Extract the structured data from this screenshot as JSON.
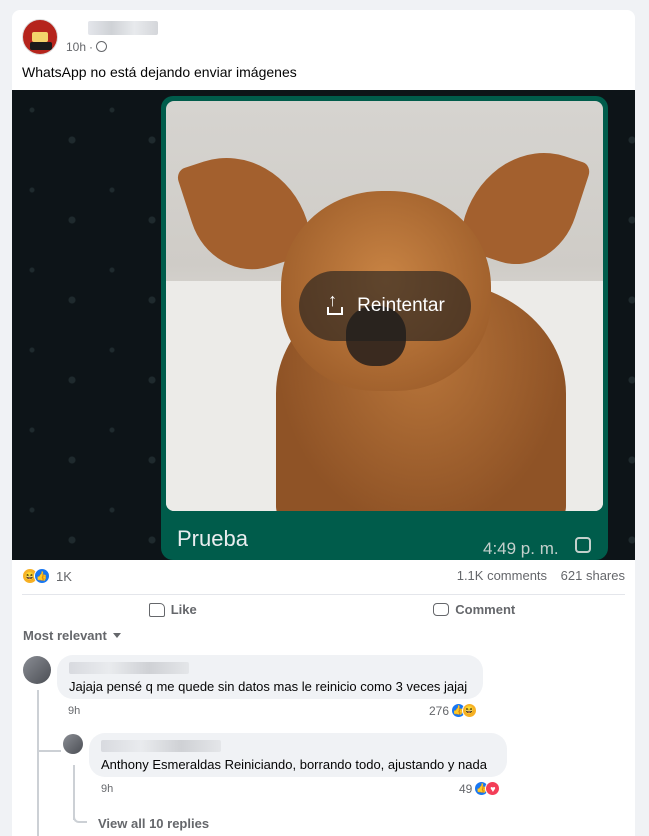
{
  "post": {
    "time": "10h",
    "time_separator": "·",
    "text": "WhatsApp no está dejando enviar imágenes"
  },
  "media": {
    "retry_label": "Reintentar",
    "caption": "Prueba",
    "message_time": "4:49 p. m."
  },
  "stats": {
    "reactions_count": "1K",
    "comments": "1.1K comments",
    "shares": "621 shares",
    "reaction_icons": [
      "haha",
      "like"
    ]
  },
  "actions": {
    "like_label": "Like",
    "comment_label": "Comment"
  },
  "comments_section": {
    "sort_label": "Most relevant",
    "comments": [
      {
        "text": "Jajaja pensé q me quede sin datos mas le reinicio como 3 veces jajaj",
        "time": "9h",
        "reactions_count": "276",
        "reaction_icons": [
          "like",
          "haha"
        ]
      },
      {
        "text": "Anthony Esmeraldas Reiniciando, borrando todo, ajustando y nada",
        "time": "9h",
        "reactions_count": "49",
        "reaction_icons": [
          "like",
          "love"
        ]
      }
    ],
    "view_replies": "View all 10 replies"
  }
}
